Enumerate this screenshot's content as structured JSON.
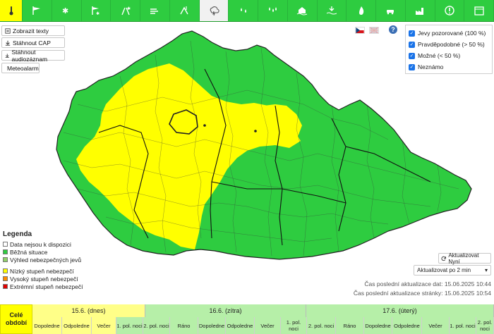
{
  "toolbar": {
    "items": [
      {
        "icon": "thermometer-icon",
        "state": "active"
      },
      {
        "icon": "wind-flag-icon",
        "state": "normal"
      },
      {
        "icon": "snow-icon",
        "state": "normal"
      },
      {
        "icon": "windsock-snow-icon",
        "state": "normal"
      },
      {
        "icon": "road-snow-icon",
        "state": "normal"
      },
      {
        "icon": "blizzard-icon",
        "state": "normal"
      },
      {
        "icon": "frost-icon",
        "state": "normal"
      },
      {
        "icon": "thunderstorm-icon",
        "state": "selected"
      },
      {
        "icon": "rain-drops-icon",
        "state": "normal"
      },
      {
        "icon": "heavy-rain-icon",
        "state": "normal"
      },
      {
        "icon": "flood-icon",
        "state": "normal"
      },
      {
        "icon": "water-level-icon",
        "state": "normal"
      },
      {
        "icon": "fire-icon",
        "state": "normal"
      },
      {
        "icon": "car-accident-icon",
        "state": "normal"
      },
      {
        "icon": "smog-factory-icon",
        "state": "normal"
      },
      {
        "icon": "warning-icon",
        "state": "normal"
      },
      {
        "icon": "calendar-icon",
        "state": "normal"
      }
    ]
  },
  "buttons": {
    "show_texts": "Zobrazit texty",
    "download_cap": "Stáhnout CAP",
    "download_audio": "Stáhnout audiozáznam",
    "meteoalarm": "Meteoalarm"
  },
  "help": "?",
  "filter": {
    "items": [
      "Jevy pozorované (100 %)",
      "Pravděpodobné (> 50 %)",
      "Možné (< 50 %)",
      "Neznámo"
    ]
  },
  "legend": {
    "title": "Legenda",
    "items": [
      {
        "label": "Data nejsou k dispozici",
        "color": "#ffffff"
      },
      {
        "label": "Běžná situace",
        "color": "#2ecc40"
      },
      {
        "label": "Výhled nebezpečných jevů",
        "color": "#8fd16a"
      },
      {
        "label": "Nízký stupeň nebezpečí",
        "color": "#ffff00"
      },
      {
        "label": "Vysoký stupeň nebezpečí",
        "color": "#ff8c00"
      },
      {
        "label": "Extrémní stupeň nebezpečí",
        "color": "#e00000"
      }
    ]
  },
  "controls": {
    "refresh_now": "Aktualizovat Nyní",
    "refresh_interval": "Aktualizovat po 2 min",
    "data_update": "Čas poslední aktualizace dat: 15.06.2025 10:44",
    "page_update": "Čas poslední aktualizace stránky: 15.06.2025 10:54"
  },
  "timeline": {
    "whole_period": "Celé období",
    "days": [
      "15.6. (dnes)",
      "16.6. (zítra)",
      "17.6. (úterý)"
    ],
    "slots": [
      "Dopoledne",
      "Odpoledne",
      "Večer",
      "1. pol. noci",
      "2. pol. noci",
      "Ráno",
      "Dopoledne",
      "Odpoledne",
      "Večer",
      "1. pol. noci",
      "2. pol. noci",
      "Ráno",
      "Dopoledne",
      "Odpoledne",
      "Večer",
      "1. pol. noci",
      "2. pol. noci"
    ]
  },
  "colors": {
    "green": "#2ecc40",
    "yellow": "#ffff00",
    "light_green": "#8fd16a"
  }
}
